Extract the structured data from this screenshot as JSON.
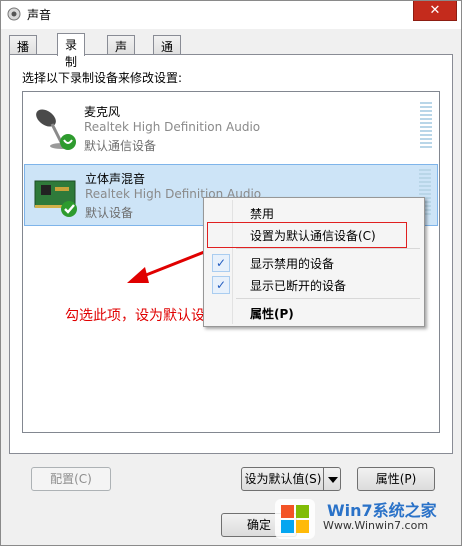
{
  "window": {
    "title": "声音",
    "close_glyph": "✕"
  },
  "tabs": [
    {
      "label": "播放",
      "active": false
    },
    {
      "label": "录制",
      "active": true
    },
    {
      "label": "声音",
      "active": false
    },
    {
      "label": "通信",
      "active": false
    }
  ],
  "instruction": "选择以下录制设备来修改设置:",
  "devices": [
    {
      "name": "麦克风",
      "driver": "Realtek High Definition Audio",
      "status": "默认通信设备",
      "icon": "microphone-icon",
      "badge": "phone-icon",
      "selected": false
    },
    {
      "name": "立体声混音",
      "driver": "Realtek High Definition Audio",
      "status": "默认设备",
      "icon": "sound-card-icon",
      "badge": "check-icon",
      "selected": true
    }
  ],
  "context_menu": {
    "items": [
      {
        "label": "禁用",
        "checked": false
      },
      {
        "label": "设置为默认通信设备(C)",
        "checked": false
      },
      {
        "label": "显示禁用的设备",
        "checked": true
      },
      {
        "label": "显示已断开的设备",
        "checked": true
      },
      {
        "label": "属性(P)",
        "checked": false,
        "bold": true
      }
    ],
    "check_glyph": "✓"
  },
  "annotation": "勾选此项，设为默认设备",
  "buttons": {
    "configure": "配置(C)",
    "set_default": "设为默认值(S)",
    "properties": "属性(P)",
    "ok": "确定"
  },
  "watermark": {
    "brand": "Win7系统之家",
    "url": "Www.Winwin7.com"
  },
  "colors": {
    "selection": "#cde4f7",
    "annotation_red": "#e00000",
    "close_red": "#c42b1c"
  }
}
